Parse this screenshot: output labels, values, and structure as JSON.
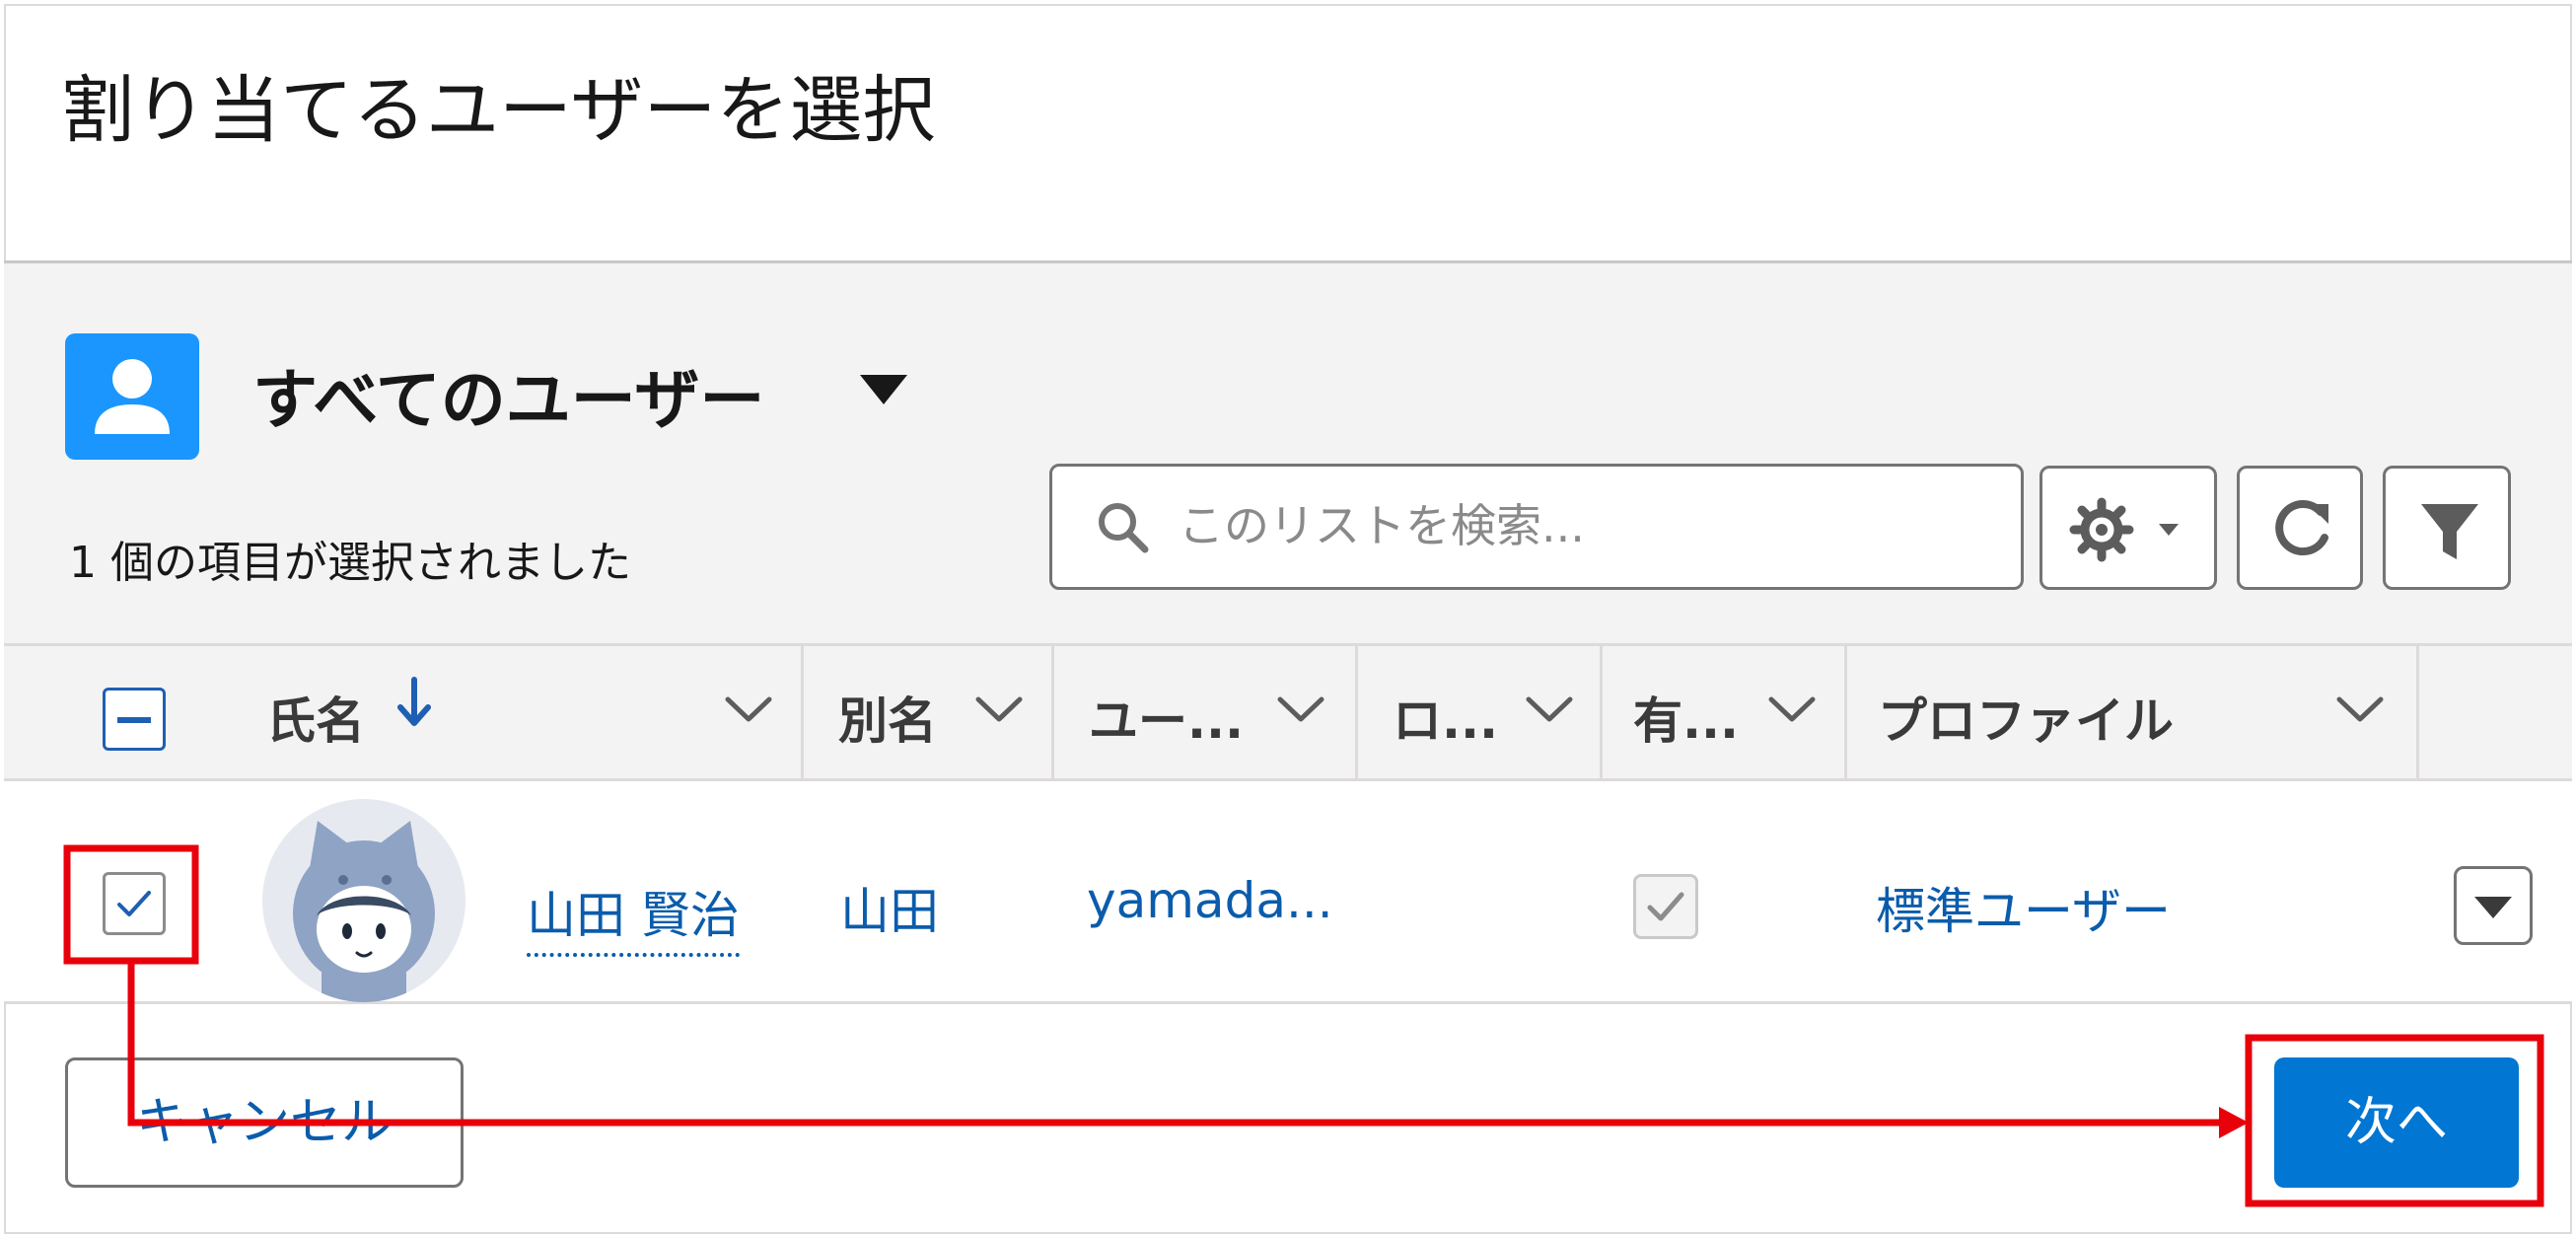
{
  "modal": {
    "title": "割り当てるユーザーを選択"
  },
  "list_view": {
    "icon": "user-icon",
    "name": "すべてのユーザー",
    "selected_count_text": "1 個の項目が選択されました",
    "search": {
      "placeholder": "このリストを検索...",
      "value": ""
    },
    "toolbar": {
      "settings_icon": "gear-icon",
      "refresh_icon": "refresh-icon",
      "filter_icon": "filter-icon"
    }
  },
  "table": {
    "columns": [
      {
        "label": "氏名",
        "sorted": "descending"
      },
      {
        "label": "別名"
      },
      {
        "label": "ユー..."
      },
      {
        "label": "ロ..."
      },
      {
        "label": "有..."
      },
      {
        "label": "プロファイル"
      }
    ],
    "rows": [
      {
        "selected": true,
        "name": "山田 賢治",
        "alias": "山田",
        "username": "yamada...",
        "role": "",
        "active": true,
        "profile": "標準ユーザー"
      }
    ]
  },
  "footer": {
    "cancel_label": "キャンセル",
    "next_label": "次へ"
  },
  "colors": {
    "brand": "#0176d3",
    "link": "#0b5cab",
    "annotation": "#e8000b",
    "icon_bg": "#1b96ff"
  }
}
